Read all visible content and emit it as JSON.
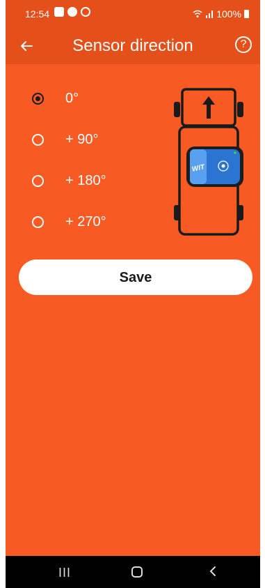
{
  "status_bar": {
    "time": "12:54",
    "icons": [
      "gallery-icon",
      "app-icon",
      "notification-icon"
    ],
    "right_icons": [
      "wifi-icon",
      "signal-icon"
    ],
    "battery": "100%"
  },
  "app_bar": {
    "back_icon": "arrow-left-icon",
    "title": "Sensor direction",
    "help_icon": "help-circle-icon",
    "help_glyph": "?"
  },
  "options": [
    {
      "label": "0°",
      "checked": true
    },
    {
      "label": "+ 90°",
      "checked": false
    },
    {
      "label": "+ 180°",
      "checked": false
    },
    {
      "label": "+ 270°",
      "checked": false
    }
  ],
  "car_illustration": {
    "arrow_direction": "up",
    "sensor_brand": "WIT"
  },
  "save_button": {
    "label": "Save"
  },
  "nav_bar": {
    "recent_glyph": "III",
    "home_icon": "home-icon",
    "back_icon": "back-icon"
  },
  "colors": {
    "background": "#f85a23",
    "app_bar": "#e44f1a",
    "accent_text": "#ffffff",
    "radio_checked": "#1a1a1a",
    "sensor_blue": "#2b74d1"
  }
}
